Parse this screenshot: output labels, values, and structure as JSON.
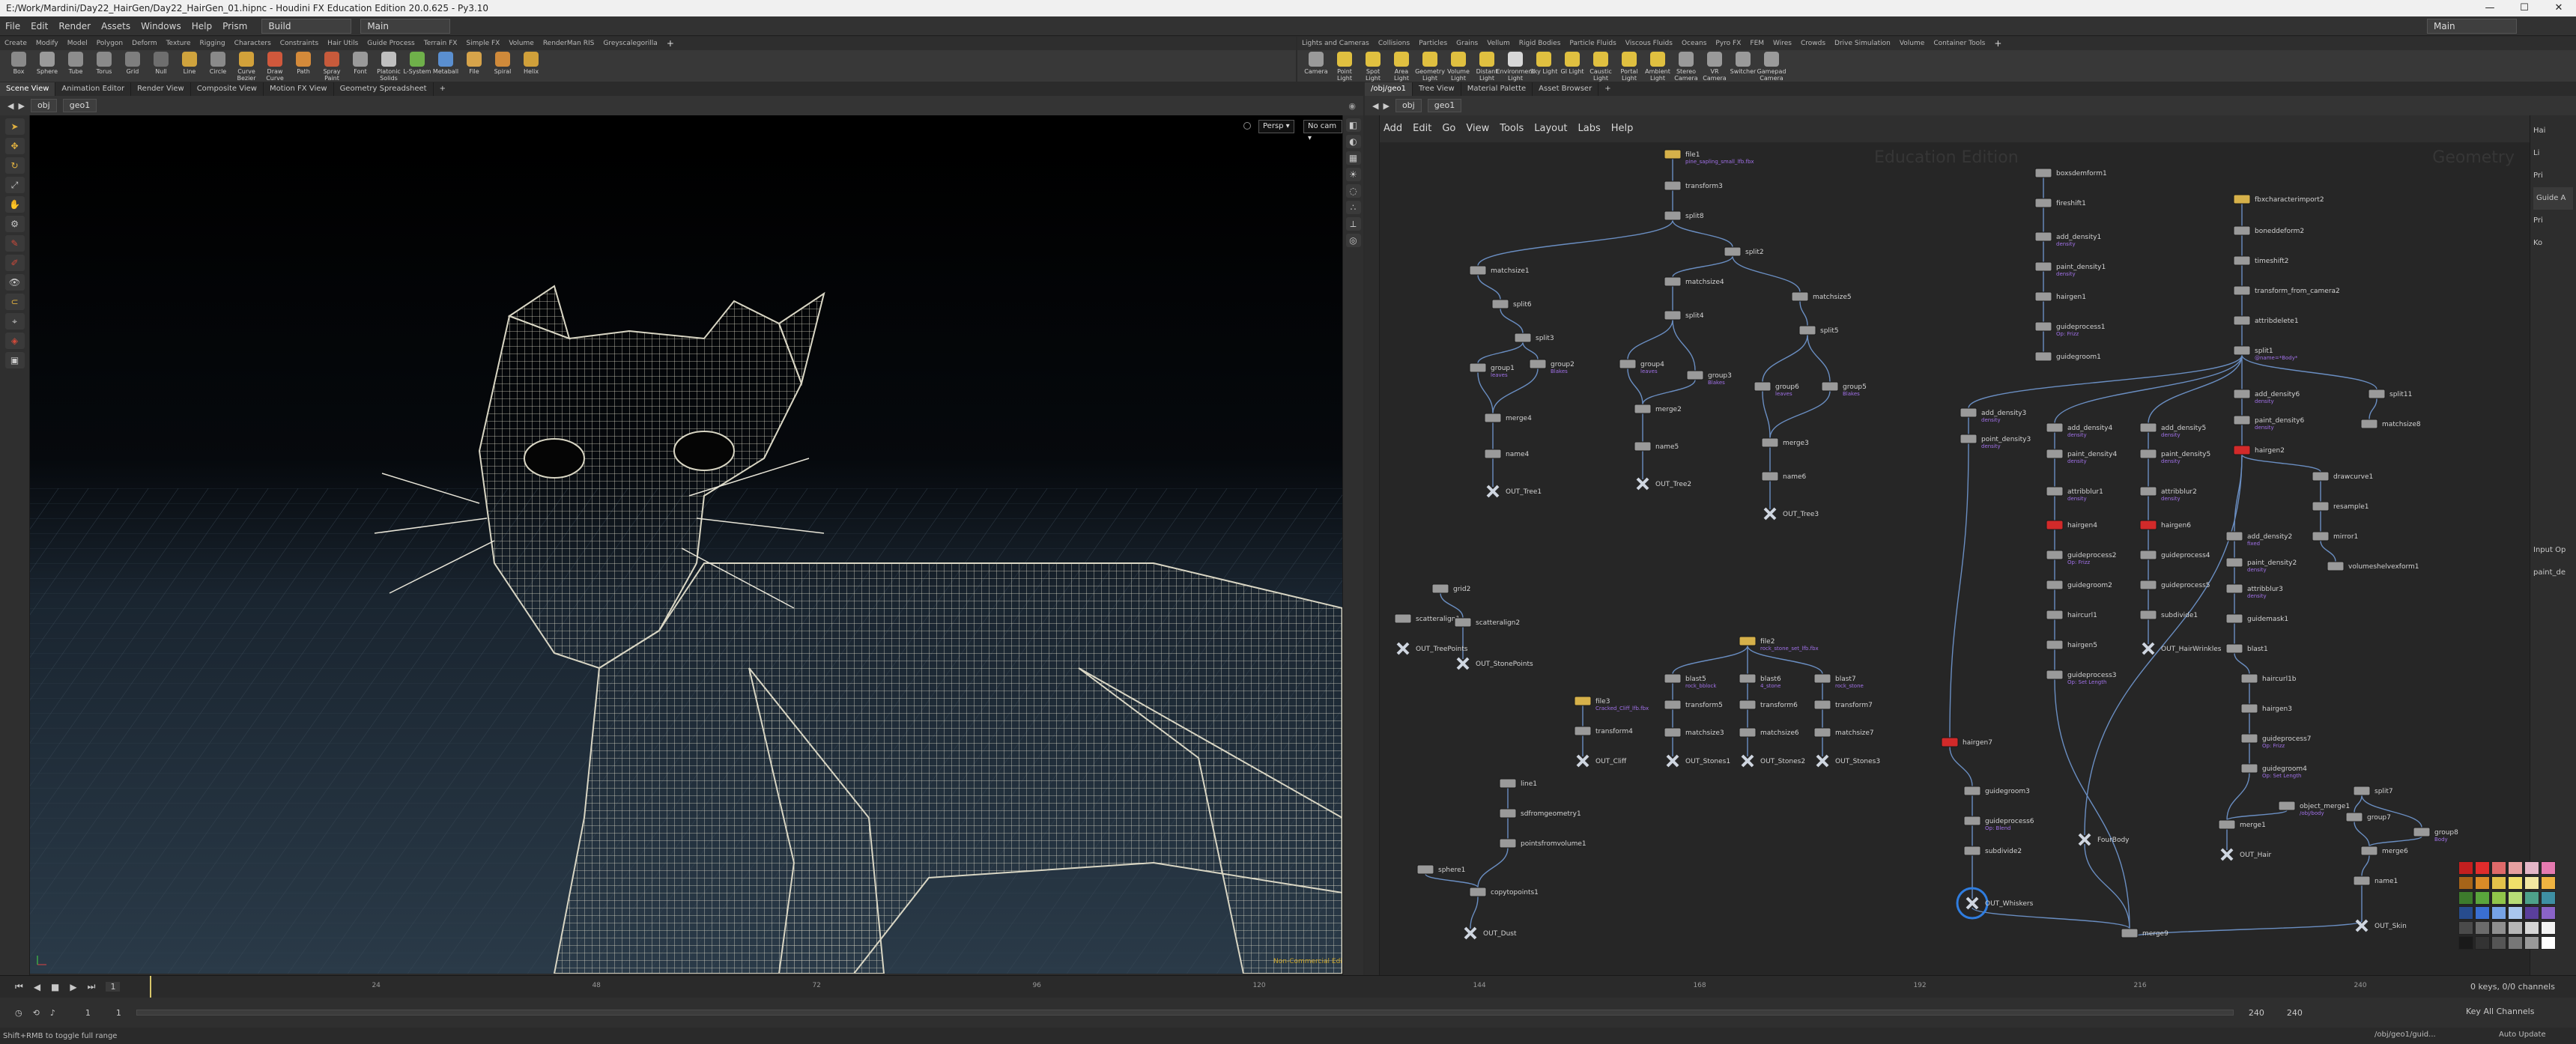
{
  "window": {
    "title": "E:/Work/Mardini/Day22_HairGen/Day22_HairGen_01.hipnc - Houdini FX Education Edition 20.0.625 - Py3.10",
    "controls": [
      "—",
      "☐",
      "✕"
    ]
  },
  "menubar": {
    "items": [
      "File",
      "Edit",
      "Render",
      "Assets",
      "Windows",
      "Help",
      "Prism"
    ],
    "desktop_build": "Build",
    "desktop_main": "Main",
    "right_desktop": "Main"
  },
  "shelf_left": {
    "tabs": [
      "Create",
      "Modify",
      "Model",
      "Polygon",
      "Deform",
      "Texture",
      "Rigging",
      "Characters",
      "Constraints",
      "Hair Utils",
      "Guide Process",
      "Terrain FX",
      "Simple FX",
      "Volume",
      "RenderMan RIS",
      "Greyscalegorilla"
    ],
    "tools": [
      {
        "label": "Box",
        "icon": "box-icon",
        "color": "#8a8a8a"
      },
      {
        "label": "Sphere",
        "icon": "sphere-icon",
        "color": "#9a9a9a"
      },
      {
        "label": "Tube",
        "icon": "tube-icon",
        "color": "#8d8d8d"
      },
      {
        "label": "Torus",
        "icon": "torus-icon",
        "color": "#8a8a8a"
      },
      {
        "label": "Grid",
        "icon": "grid-icon",
        "color": "#7e7e7e"
      },
      {
        "label": "Null",
        "icon": "null-icon",
        "color": "#6e6e6e"
      },
      {
        "label": "Line",
        "icon": "line-icon",
        "color": "#cfa33d"
      },
      {
        "label": "Circle",
        "icon": "circle-icon",
        "color": "#8a8a8a"
      },
      {
        "label": "Curve Bezier",
        "icon": "curve-bezier-icon",
        "color": "#d2a13a"
      },
      {
        "label": "Draw Curve",
        "icon": "draw-curve-icon",
        "color": "#d0583c"
      },
      {
        "label": "Path",
        "icon": "path-icon",
        "color": "#d48a3a"
      },
      {
        "label": "Spray Paint",
        "icon": "spray-paint-icon",
        "color": "#c75a3b"
      },
      {
        "label": "Font",
        "icon": "font-icon",
        "color": "#9a9a9a"
      },
      {
        "label": "Platonic Solids",
        "icon": "platonic-solids-icon",
        "color": "#c0c0c0"
      },
      {
        "label": "L-System",
        "icon": "l-system-icon",
        "color": "#6fb04a"
      },
      {
        "label": "Metaball",
        "icon": "metaball-icon",
        "color": "#5a8fd0"
      },
      {
        "label": "File",
        "icon": "file-icon",
        "color": "#d6a34a"
      },
      {
        "label": "Spiral",
        "icon": "spiral-icon",
        "color": "#d08a3a"
      },
      {
        "label": "Helix",
        "icon": "helix-icon",
        "color": "#d0a03a"
      }
    ]
  },
  "shelf_right": {
    "tabs": [
      "Lights and Cameras",
      "Collisions",
      "Particles",
      "Grains",
      "Vellum",
      "Rigid Bodies",
      "Particle Fluids",
      "Viscous Fluids",
      "Oceans",
      "Pyro FX",
      "FEM",
      "Wires",
      "Crowds",
      "Drive Simulation",
      "Volume",
      "Container Tools"
    ],
    "tools": [
      {
        "label": "Camera",
        "icon": "camera-icon",
        "color": "#9a9a9a"
      },
      {
        "label": "Point Light",
        "icon": "point-light-icon",
        "color": "#e0c040"
      },
      {
        "label": "Spot Light",
        "icon": "spot-light-icon",
        "color": "#e0c040"
      },
      {
        "label": "Area Light",
        "icon": "area-light-icon",
        "color": "#e0c040"
      },
      {
        "label": "Geometry Light",
        "icon": "geometry-light-icon",
        "color": "#e0c040"
      },
      {
        "label": "Volume Light",
        "icon": "volume-light-icon",
        "color": "#e0c040"
      },
      {
        "label": "Distant Light",
        "icon": "distant-light-icon",
        "color": "#e0c040"
      },
      {
        "label": "Environment Light",
        "icon": "environment-light-icon",
        "color": "#d8d8d8"
      },
      {
        "label": "Sky Light",
        "icon": "sky-light-icon",
        "color": "#e0c040"
      },
      {
        "label": "GI Light",
        "icon": "gi-light-icon",
        "color": "#e0c040"
      },
      {
        "label": "Caustic Light",
        "icon": "caustic-light-icon",
        "color": "#e0c040"
      },
      {
        "label": "Portal Light",
        "icon": "portal-light-icon",
        "color": "#e0c040"
      },
      {
        "label": "Ambient Light",
        "icon": "ambient-light-icon",
        "color": "#e0c040"
      },
      {
        "label": "Stereo Camera",
        "icon": "stereo-camera-icon",
        "color": "#9a9a9a"
      },
      {
        "label": "VR Camera",
        "icon": "vr-camera-icon",
        "color": "#9a9a9a"
      },
      {
        "label": "Switcher",
        "icon": "switcher-icon",
        "color": "#9a9a9a"
      },
      {
        "label": "Gamepad Camera",
        "icon": "gamepad-camera-icon",
        "color": "#9a9a9a"
      }
    ]
  },
  "viewer": {
    "tabs": [
      "Scene View",
      "Animation Editor",
      "Render View",
      "Composite View",
      "Motion FX View",
      "Geometry Spreadsheet"
    ],
    "active_tab": 0,
    "path": [
      "obj",
      "geo1"
    ],
    "camera_menu": "Persp ▾",
    "cam_menu": "No cam ▾",
    "status_corner": "Non-Commercial Edition"
  },
  "network": {
    "tabs": [
      "/obj/geo1",
      "Tree View",
      "Material Palette",
      "Asset Browser"
    ],
    "active_tab": 0,
    "path": [
      "obj",
      "geo1"
    ],
    "menu": [
      "Add",
      "Edit",
      "Go",
      "View",
      "Tools",
      "Layout",
      "Labs",
      "Help"
    ],
    "watermark_left": "Education Edition",
    "watermark_right": "Geometry",
    "nodes": [
      {
        "name": "file1",
        "kind": "file",
        "sub": "pine_sapling_small_lfb.fbx"
      },
      {
        "name": "transform3",
        "kind": "sop"
      },
      {
        "name": "split8",
        "kind": "sop"
      },
      {
        "name": "matchsize1",
        "kind": "sop"
      },
      {
        "name": "split2",
        "kind": "sop"
      },
      {
        "name": "matchsize4",
        "kind": "sop"
      },
      {
        "name": "matchsize5",
        "kind": "sop"
      },
      {
        "name": "split6",
        "kind": "sop"
      },
      {
        "name": "split4",
        "kind": "sop"
      },
      {
        "name": "split5",
        "kind": "sop"
      },
      {
        "name": "split3",
        "kind": "sop"
      },
      {
        "name": "group1",
        "kind": "sop",
        "sub": "leaves"
      },
      {
        "name": "group2",
        "kind": "sop",
        "sub": "Blakes"
      },
      {
        "name": "group4",
        "kind": "sop",
        "sub": "leaves"
      },
      {
        "name": "group3",
        "kind": "sop",
        "sub": "Blakes"
      },
      {
        "name": "group6",
        "kind": "sop",
        "sub": "leaves"
      },
      {
        "name": "group5",
        "kind": "sop",
        "sub": "Blakes"
      },
      {
        "name": "merge4",
        "kind": "sop"
      },
      {
        "name": "merge2",
        "kind": "sop"
      },
      {
        "name": "merge3",
        "kind": "sop"
      },
      {
        "name": "name4",
        "kind": "sop"
      },
      {
        "name": "name5",
        "kind": "sop"
      },
      {
        "name": "name6",
        "kind": "sop"
      },
      {
        "name": "OUT_Tree1",
        "kind": "null"
      },
      {
        "name": "OUT_Tree2",
        "kind": "null"
      },
      {
        "name": "OUT_Tree3",
        "kind": "null"
      },
      {
        "name": "grid2",
        "kind": "sop"
      },
      {
        "name": "scatteralign1",
        "kind": "sop"
      },
      {
        "name": "scatteralign2",
        "kind": "sop"
      },
      {
        "name": "OUT_StonePoints",
        "kind": "null"
      },
      {
        "name": "OUT_TreePoints",
        "kind": "null"
      },
      {
        "name": "file2",
        "kind": "file",
        "sub": "rock_stone_set_lfb.fbx"
      },
      {
        "name": "file3",
        "kind": "file",
        "sub": "Cracked_Cliff_lfb.fbx"
      },
      {
        "name": "blast5",
        "kind": "sop",
        "sub": "rock_bblock"
      },
      {
        "name": "blast6",
        "kind": "sop",
        "sub": "4_stone"
      },
      {
        "name": "blast7",
        "kind": "sop",
        "sub": "rock_stone"
      },
      {
        "name": "transform5",
        "kind": "sop"
      },
      {
        "name": "transform6",
        "kind": "sop"
      },
      {
        "name": "transform7",
        "kind": "sop"
      },
      {
        "name": "transform4",
        "kind": "sop"
      },
      {
        "name": "matchsize3",
        "kind": "sop"
      },
      {
        "name": "matchsize6",
        "kind": "sop"
      },
      {
        "name": "matchsize7",
        "kind": "sop"
      },
      {
        "name": "OUT_Cliff",
        "kind": "null"
      },
      {
        "name": "OUT_Stones1",
        "kind": "null"
      },
      {
        "name": "OUT_Stones2",
        "kind": "null"
      },
      {
        "name": "OUT_Stones3",
        "kind": "null"
      },
      {
        "name": "line1",
        "kind": "sop"
      },
      {
        "name": "sdfromgeometry1",
        "kind": "sop"
      },
      {
        "name": "pointsfromvolume1",
        "kind": "sop"
      },
      {
        "name": "sphere1",
        "kind": "sop"
      },
      {
        "name": "copytopoints1",
        "kind": "sop"
      },
      {
        "name": "OUT_Dust",
        "kind": "null"
      },
      {
        "name": "boxsdemform1",
        "kind": "sop"
      },
      {
        "name": "fireshift1",
        "kind": "sop"
      },
      {
        "name": "add_density1",
        "kind": "sop",
        "sub": "density"
      },
      {
        "name": "paint_density1",
        "kind": "sop",
        "sub": "density"
      },
      {
        "name": "hairgen1",
        "kind": "sop"
      },
      {
        "name": "guideprocess1",
        "kind": "sop",
        "sub": "Op: Frizz"
      },
      {
        "name": "guidegroom1",
        "kind": "sop"
      },
      {
        "name": "fbxcharacterimport2",
        "kind": "file"
      },
      {
        "name": "boneddeform2",
        "kind": "sop"
      },
      {
        "name": "timeshift2",
        "kind": "sop"
      },
      {
        "name": "transform_from_camera2",
        "kind": "sop"
      },
      {
        "name": "attribdelete1",
        "kind": "sop"
      },
      {
        "name": "split1",
        "kind": "sop",
        "sub": "@name=*Body*"
      },
      {
        "name": "add_density3",
        "kind": "sop",
        "sub": "density"
      },
      {
        "name": "point_density3",
        "kind": "sop",
        "sub": "density"
      },
      {
        "name": "add_density4",
        "kind": "sop",
        "sub": "density"
      },
      {
        "name": "paint_density4",
        "kind": "sop",
        "sub": "density"
      },
      {
        "name": "add_density5",
        "kind": "sop",
        "sub": "density"
      },
      {
        "name": "paint_density5",
        "kind": "sop",
        "sub": "density"
      },
      {
        "name": "add_density6",
        "kind": "sop",
        "sub": "density"
      },
      {
        "name": "paint_density6",
        "kind": "sop",
        "sub": "density"
      },
      {
        "name": "split11",
        "kind": "sop"
      },
      {
        "name": "matchsize8",
        "kind": "sop"
      },
      {
        "name": "attribblur1",
        "kind": "sop",
        "sub": "density"
      },
      {
        "name": "attribblur2",
        "kind": "sop",
        "sub": "density"
      },
      {
        "name": "hairgen4",
        "kind": "error"
      },
      {
        "name": "hairgen6",
        "kind": "error"
      },
      {
        "name": "hairgen2",
        "kind": "error"
      },
      {
        "name": "guideprocess2",
        "kind": "sop",
        "sub": "Op: Frizz"
      },
      {
        "name": "guidegroom2",
        "kind": "sop"
      },
      {
        "name": "haircurl1",
        "kind": "sop"
      },
      {
        "name": "hairgen5",
        "kind": "sop"
      },
      {
        "name": "guideprocess3",
        "kind": "sop",
        "sub": "Op: Set Length"
      },
      {
        "name": "guideprocess4",
        "kind": "sop"
      },
      {
        "name": "guideprocess5",
        "kind": "sop"
      },
      {
        "name": "subdivide1",
        "kind": "sop"
      },
      {
        "name": "OUT_HairWrinkles",
        "kind": "null"
      },
      {
        "name": "hairgen7",
        "kind": "error"
      },
      {
        "name": "guidegroom3",
        "kind": "sop"
      },
      {
        "name": "guideprocess6",
        "kind": "sop",
        "sub": "Op: Blend"
      },
      {
        "name": "subdivide2",
        "kind": "sop"
      },
      {
        "name": "OUT_Whiskers",
        "kind": "null"
      },
      {
        "name": "FourBody",
        "kind": "null"
      },
      {
        "name": "merge9",
        "kind": "sop"
      },
      {
        "name": "drawcurve1",
        "kind": "sop"
      },
      {
        "name": "resample1",
        "kind": "sop"
      },
      {
        "name": "mirror1",
        "kind": "sop"
      },
      {
        "name": "volumeshelvexform1",
        "kind": "sop"
      },
      {
        "name": "add_density2",
        "kind": "sop",
        "sub": "fixed"
      },
      {
        "name": "paint_density2",
        "kind": "sop",
        "sub": "density"
      },
      {
        "name": "attribblur3",
        "kind": "sop",
        "sub": "density"
      },
      {
        "name": "guidemask1",
        "kind": "sop"
      },
      {
        "name": "blast1",
        "kind": "sop"
      },
      {
        "name": "haircurl1b",
        "kind": "sop"
      },
      {
        "name": "hairgen3",
        "kind": "sop"
      },
      {
        "name": "guideprocess7",
        "kind": "sop",
        "sub": "Op: Frizz"
      },
      {
        "name": "guidegroom4",
        "kind": "sop",
        "sub": "Op: Set Length"
      },
      {
        "name": "object_merge1",
        "kind": "sop",
        "sub": "/obj/body"
      },
      {
        "name": "merge1",
        "kind": "sop"
      },
      {
        "name": "split7",
        "kind": "sop"
      },
      {
        "name": "group7",
        "kind": "sop"
      },
      {
        "name": "group8",
        "kind": "sop",
        "sub": "Body"
      },
      {
        "name": "merge6",
        "kind": "sop"
      },
      {
        "name": "OUT_Hair",
        "kind": "null"
      },
      {
        "name": "name1",
        "kind": "sop"
      },
      {
        "name": "OUT_Skin",
        "kind": "null"
      }
    ]
  },
  "parm_strip": {
    "labels": [
      "Hai",
      "Li",
      "Pri",
      "Guide A",
      "Pri",
      "Ko",
      "Input Op",
      "paint_de"
    ]
  },
  "palette": {
    "colors": [
      "#c41f1f",
      "#e02c2c",
      "#e06a6a",
      "#e7a0a0",
      "#e4b6c7",
      "#e57ab0",
      "#a66418",
      "#d98b27",
      "#e3c24a",
      "#f1e06a",
      "#f2e7a1",
      "#efb341",
      "#3d7b2c",
      "#5aa53c",
      "#90c54a",
      "#b8dc77",
      "#4ea18a",
      "#3e8fa3",
      "#274c8e",
      "#3a6fd1",
      "#76a3e6",
      "#a9c6ee",
      "#5a3f9c",
      "#8a63c7",
      "#4a4a4a",
      "#6b6b6b",
      "#8f8f8f",
      "#b6b6b6",
      "#d6d6d6",
      "#f2f2f2",
      "#1a1a1a",
      "#333333",
      "#555555",
      "#777777",
      "#999999",
      "#ffffff"
    ]
  },
  "timeline": {
    "current_frame": "1",
    "start": "1",
    "start2": "1",
    "end": "240",
    "end2": "240",
    "ticks": [
      "24",
      "48",
      "72",
      "96",
      "120",
      "144",
      "168",
      "192",
      "216",
      "240"
    ],
    "keys_label": "0 keys, 0/0 channels",
    "key_all": "Key All Channels",
    "auto_update": "Auto Update",
    "path": "/obj/geo1/guid..."
  },
  "statusbar": {
    "message": "Shift+RMB to toggle full range"
  }
}
